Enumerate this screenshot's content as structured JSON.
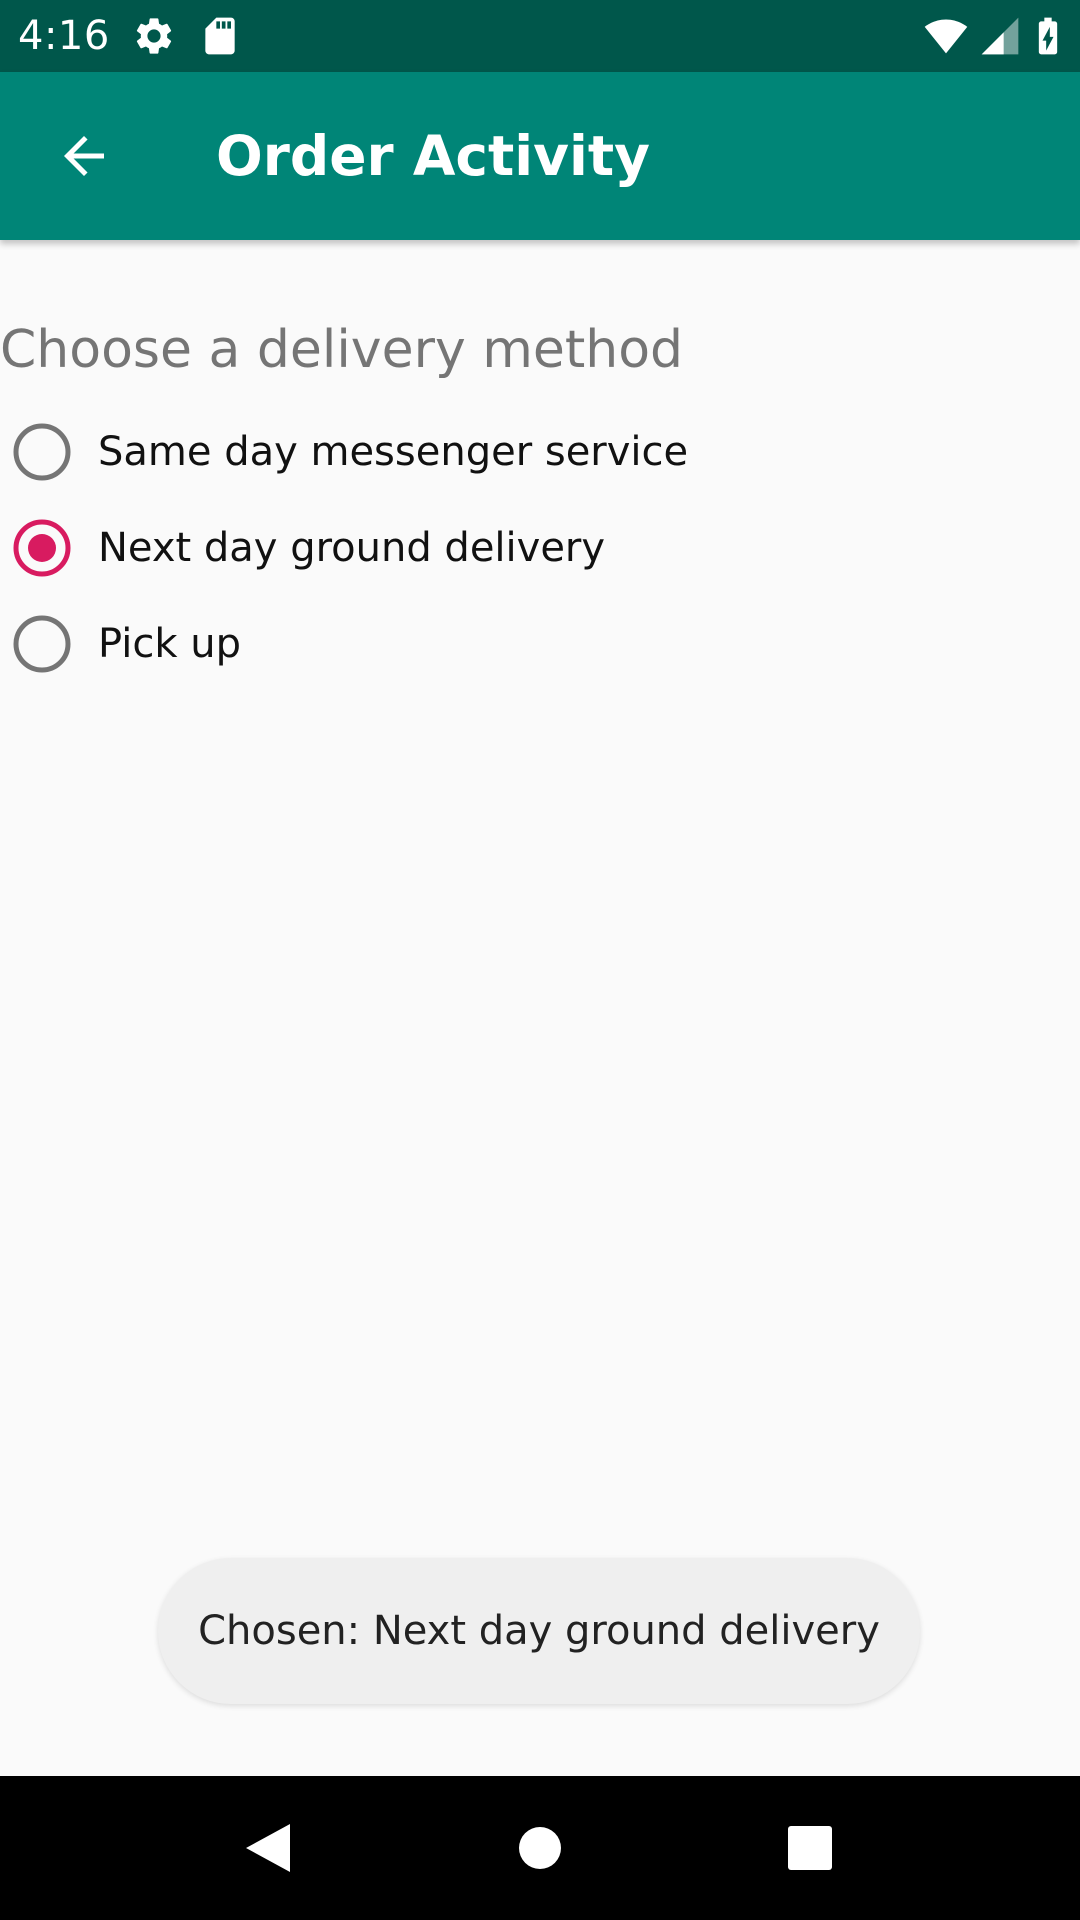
{
  "status_bar": {
    "time": "4:16",
    "icons": [
      "gear-icon",
      "sd-card-icon",
      "wifi-icon",
      "cell-signal-icon",
      "battery-charging-icon"
    ]
  },
  "app_bar": {
    "title": "Order Activity",
    "back_icon": "arrow-back-icon"
  },
  "content": {
    "heading": "Choose a delivery method",
    "options": [
      {
        "label": "Same day messenger service",
        "selected": false
      },
      {
        "label": "Next day ground delivery",
        "selected": true
      },
      {
        "label": "Pick up",
        "selected": false
      }
    ]
  },
  "toast": {
    "text": "Chosen: Next day ground delivery"
  },
  "nav_bar": {
    "buttons": [
      "back-triangle-icon",
      "home-circle-icon",
      "recents-square-icon"
    ]
  },
  "colors": {
    "status_bar": "#00574b",
    "app_bar": "#008577",
    "radio_selected": "#d81b60",
    "radio_unselected": "#757575",
    "background": "#fafafa"
  }
}
